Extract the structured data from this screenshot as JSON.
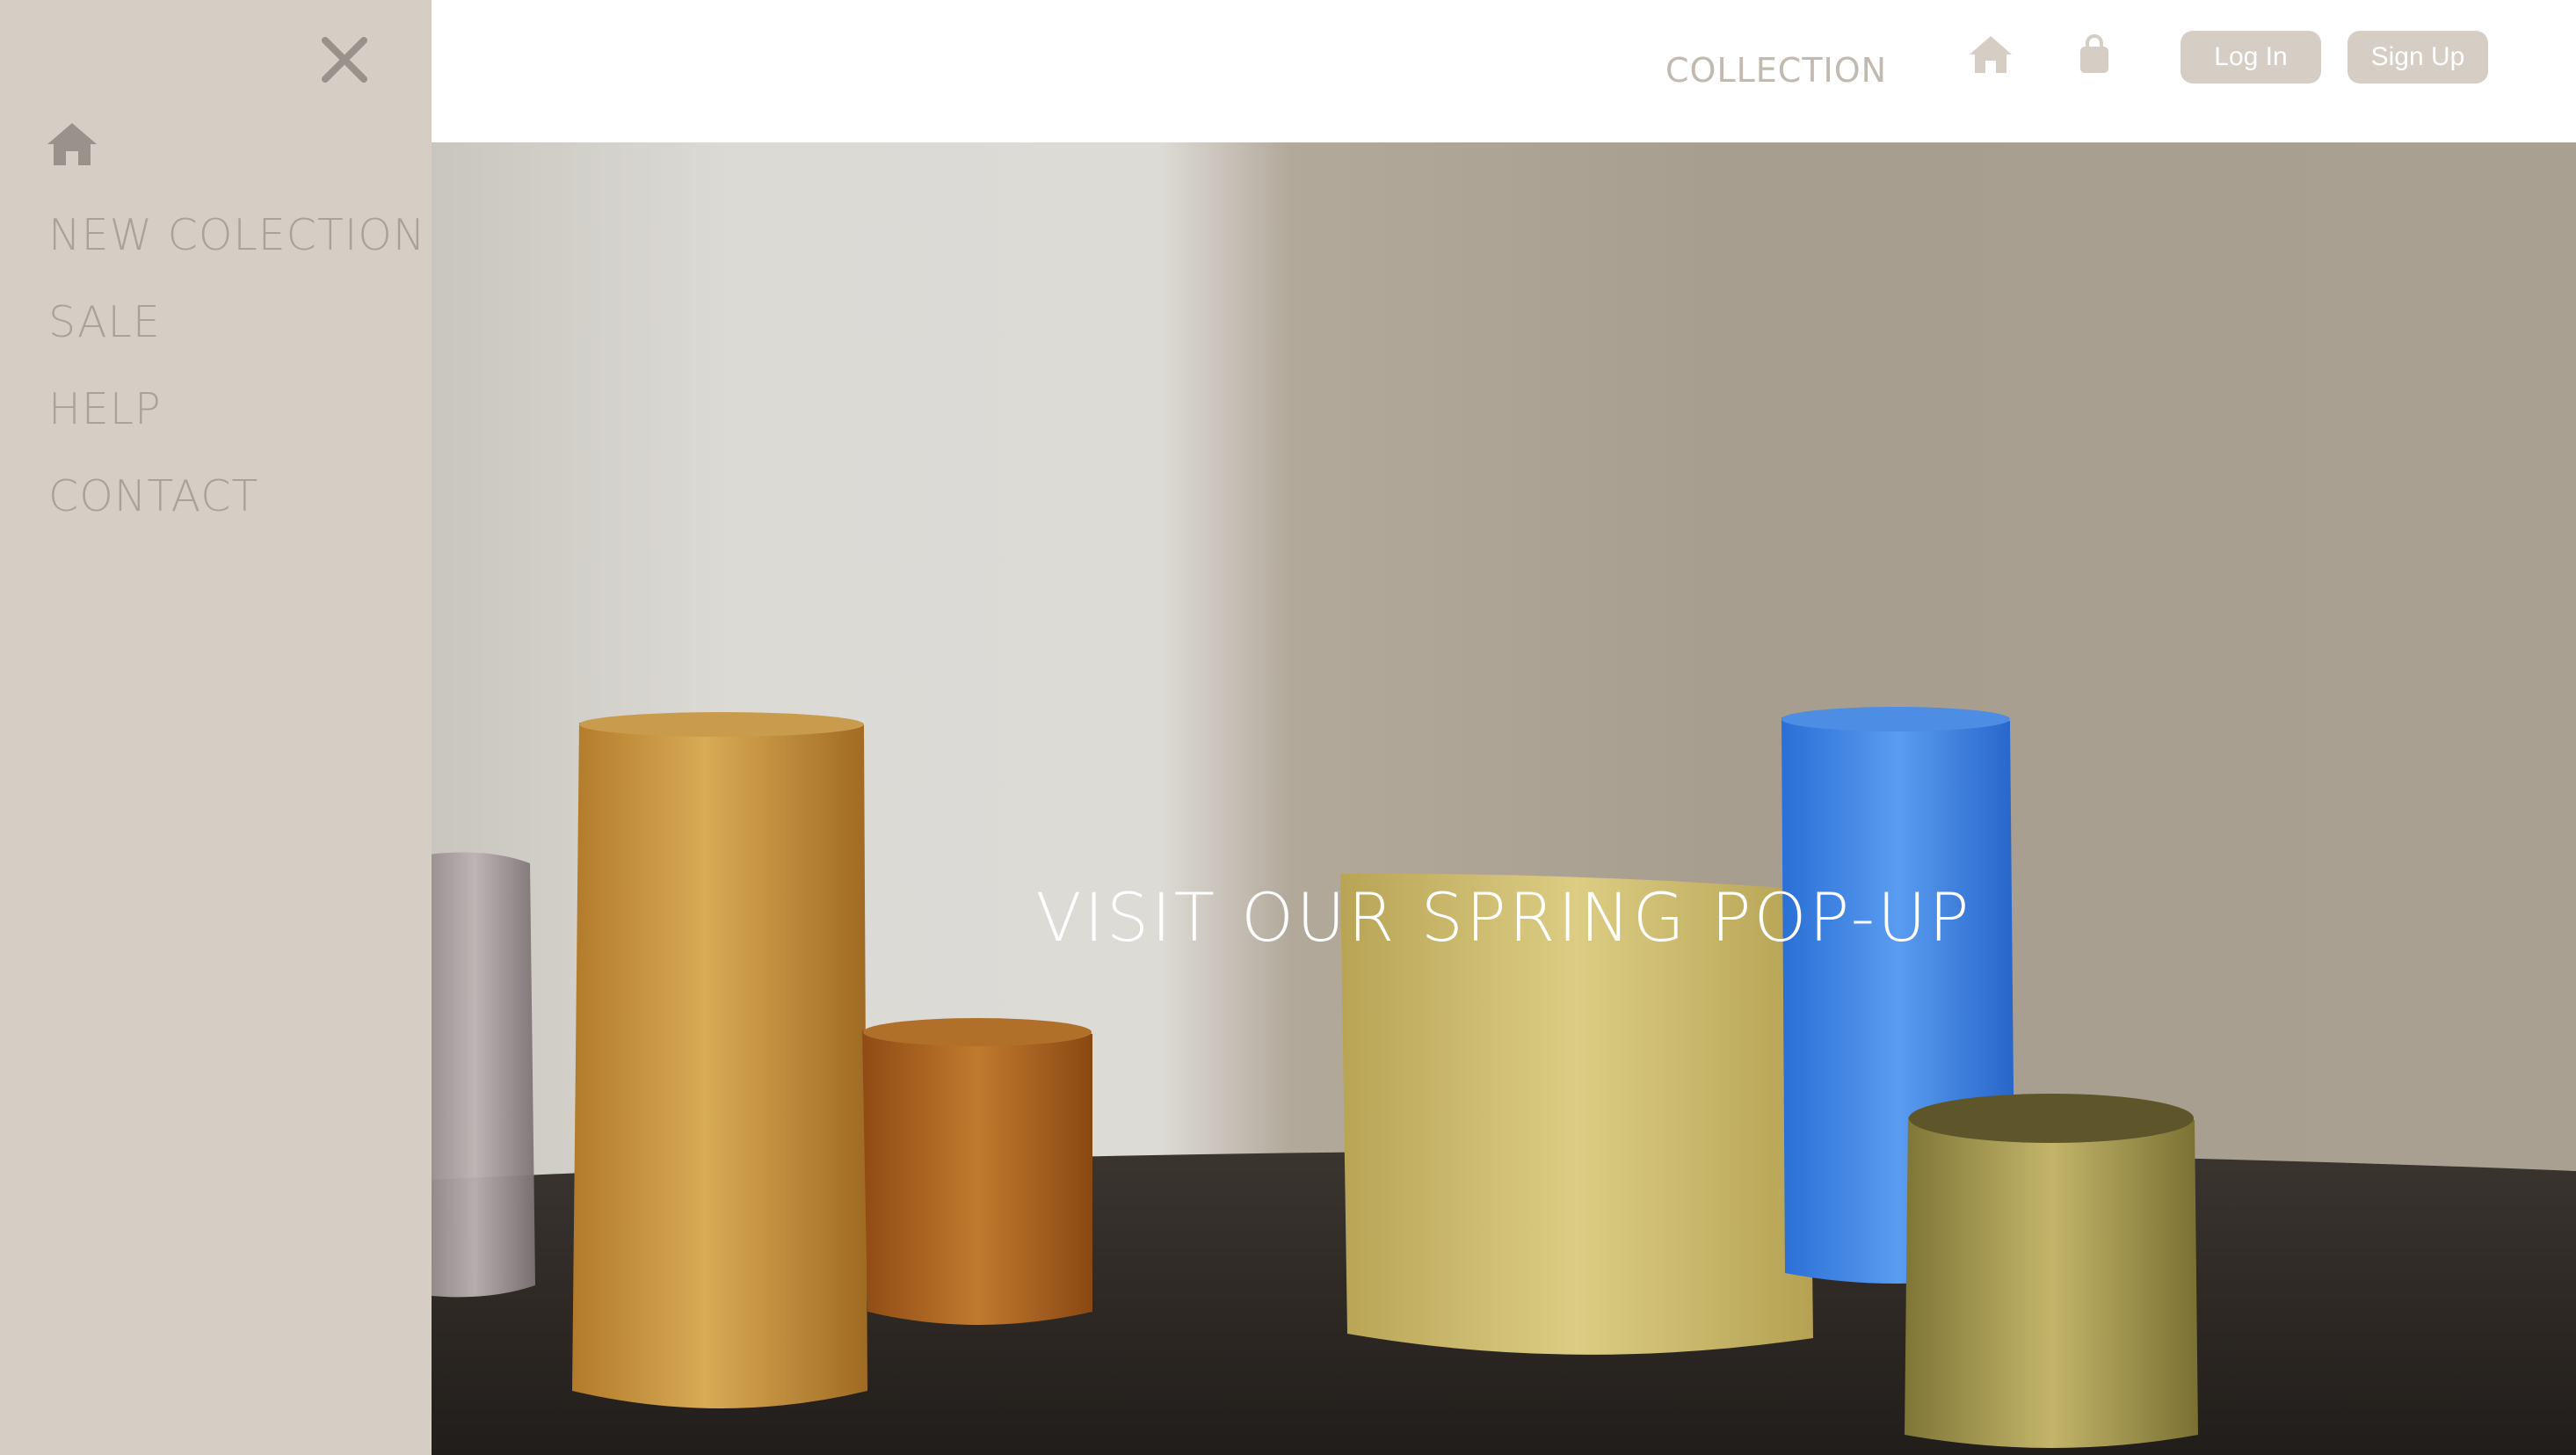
{
  "sidebar": {
    "close_icon": "close-icon",
    "home_icon": "home-icon",
    "items": [
      {
        "label": "NEW COLECTION"
      },
      {
        "label": "SALE"
      },
      {
        "label": "HELP"
      },
      {
        "label": "CONTACT"
      }
    ]
  },
  "header": {
    "nav_label": "COLLECTION",
    "home_icon": "home-icon",
    "bag_icon": "shopping-bag-icon",
    "login_label": "Log In",
    "signup_label": "Sign Up"
  },
  "hero": {
    "title": "VISIT OUR SPRING POP-UP"
  },
  "colors": {
    "sidebar_bg": "#d6cec5",
    "sidebar_text": "#aaa29a",
    "header_text": "#c2b9b0",
    "button_bg": "#d6cec5",
    "button_text": "#ffffff"
  }
}
